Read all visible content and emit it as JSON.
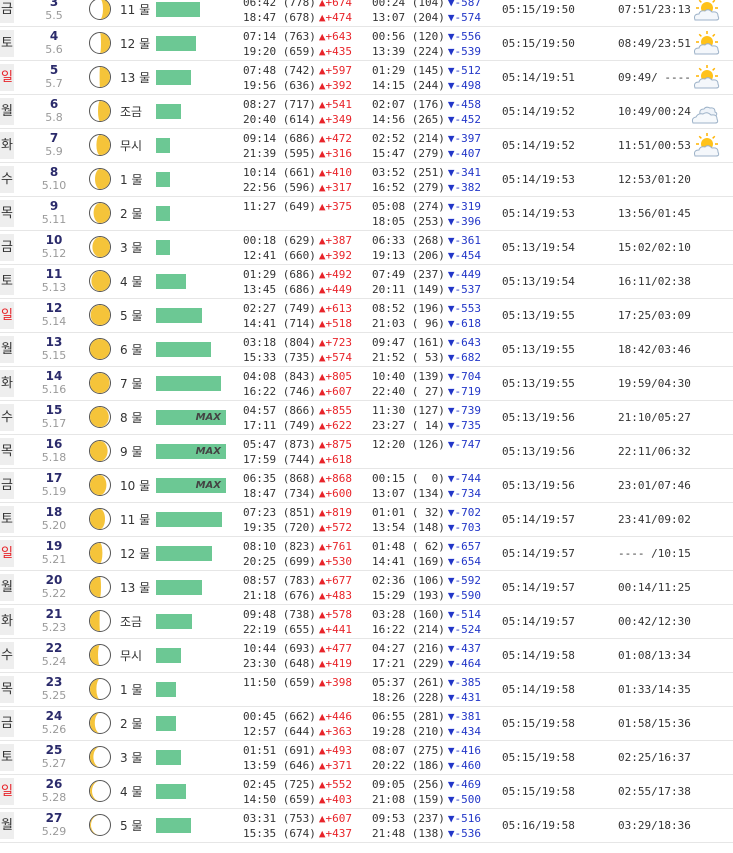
{
  "labels": {
    "max": "MAX"
  },
  "colors": {
    "bar": "#6cc894",
    "up": "#e8242a",
    "down": "#2236c8",
    "moon": "#f5c43a"
  },
  "rows": [
    {
      "dow": "금",
      "red": false,
      "day": "3",
      "lunar": "5.5",
      "illum": 0.35,
      "waxing": true,
      "mul": "11 물",
      "bar": 44,
      "max": false,
      "high1": "06:42 (778)",
      "hd1": "▲+674",
      "high2": "18:47 (678)",
      "hd2": "▲+474",
      "low1": "00:24 (104)",
      "ld1": "▼-587",
      "low2": "13:07 (204)",
      "ld2": "▼-574",
      "sun": "05:15/19:50",
      "moonrs": "07:51/23:13",
      "weather": "partly-sunny-icon"
    },
    {
      "dow": "토",
      "red": false,
      "day": "4",
      "lunar": "5.6",
      "illum": 0.45,
      "waxing": true,
      "mul": "12 물",
      "bar": 40,
      "max": false,
      "high1": "07:14 (763)",
      "hd1": "▲+643",
      "high2": "19:20 (659)",
      "hd2": "▲+435",
      "low1": "00:56 (120)",
      "ld1": "▼-556",
      "low2": "13:39 (224)",
      "ld2": "▼-539",
      "sun": "05:15/19:50",
      "moonrs": "08:49/23:51",
      "weather": "partly-sunny-icon"
    },
    {
      "dow": "일",
      "red": true,
      "day": "5",
      "lunar": "5.7",
      "illum": 0.52,
      "waxing": true,
      "mul": "13 물",
      "bar": 35,
      "max": false,
      "high1": "07:48 (742)",
      "hd1": "▲+597",
      "high2": "19:56 (636)",
      "hd2": "▲+392",
      "low1": "01:29 (145)",
      "ld1": "▼-512",
      "low2": "14:15 (244)",
      "ld2": "▼-498",
      "sun": "05:14/19:51",
      "moonrs": "09:49/ ----",
      "weather": "partly-sunny-icon"
    },
    {
      "dow": "월",
      "red": false,
      "day": "6",
      "lunar": "5.8",
      "illum": 0.6,
      "waxing": true,
      "mul": "조금",
      "bar": 25,
      "max": false,
      "high1": "08:27 (717)",
      "hd1": "▲+541",
      "high2": "20:40 (614)",
      "hd2": "▲+349",
      "low1": "02:07 (176)",
      "ld1": "▼-458",
      "low2": "14:56 (265)",
      "ld2": "▼-452",
      "sun": "05:14/19:52",
      "moonrs": "10:49/00:24",
      "weather": "cloudy-icon"
    },
    {
      "dow": "화",
      "red": false,
      "day": "7",
      "lunar": "5.9",
      "illum": 0.68,
      "waxing": true,
      "mul": "무시",
      "bar": 14,
      "max": false,
      "high1": "09:14 (686)",
      "hd1": "▲+472",
      "high2": "21:39 (595)",
      "hd2": "▲+316",
      "low1": "02:52 (214)",
      "ld1": "▼-397",
      "low2": "15:47 (279)",
      "ld2": "▼-407",
      "sun": "05:14/19:52",
      "moonrs": "11:51/00:53",
      "weather": "partly-sunny-icon"
    },
    {
      "dow": "수",
      "red": false,
      "day": "8",
      "lunar": "5.10",
      "illum": 0.75,
      "waxing": true,
      "mul": "1 물",
      "bar": 14,
      "max": false,
      "high1": "10:14 (661)",
      "hd1": "▲+410",
      "high2": "22:56 (596)",
      "hd2": "▲+317",
      "low1": "03:52 (251)",
      "ld1": "▼-341",
      "low2": "16:52 (279)",
      "ld2": "▼-382",
      "sun": "05:14/19:53",
      "moonrs": "12:53/01:20",
      "weather": ""
    },
    {
      "dow": "목",
      "red": false,
      "day": "9",
      "lunar": "5.11",
      "illum": 0.82,
      "waxing": true,
      "mul": "2 물",
      "bar": 14,
      "max": false,
      "high1": "11:27 (649)",
      "hd1": "▲+375",
      "high2": "",
      "hd2": "",
      "low1": "05:08 (274)",
      "ld1": "▼-319",
      "low2": "18:05 (253)",
      "ld2": "▼-396",
      "sun": "05:14/19:53",
      "moonrs": "13:56/01:45",
      "weather": ""
    },
    {
      "dow": "금",
      "red": false,
      "day": "10",
      "lunar": "5.12",
      "illum": 0.88,
      "waxing": true,
      "mul": "3 물",
      "bar": 14,
      "max": false,
      "high1": "00:18 (629)",
      "hd1": "▲+387",
      "high2": "12:41 (660)",
      "hd2": "▲+392",
      "low1": "06:33 (268)",
      "ld1": "▼-361",
      "low2": "19:13 (206)",
      "ld2": "▼-454",
      "sun": "05:13/19:54",
      "moonrs": "15:02/02:10",
      "weather": ""
    },
    {
      "dow": "토",
      "red": false,
      "day": "11",
      "lunar": "5.13",
      "illum": 0.93,
      "waxing": true,
      "mul": "4 물",
      "bar": 30,
      "max": false,
      "high1": "01:29 (686)",
      "hd1": "▲+492",
      "high2": "13:45 (686)",
      "hd2": "▲+449",
      "low1": "07:49 (237)",
      "ld1": "▼-449",
      "low2": "20:11 (149)",
      "ld2": "▼-537",
      "sun": "05:13/19:54",
      "moonrs": "16:11/02:38",
      "weather": ""
    },
    {
      "dow": "일",
      "red": true,
      "day": "12",
      "lunar": "5.14",
      "illum": 0.97,
      "waxing": true,
      "mul": "5 물",
      "bar": 46,
      "max": false,
      "high1": "02:27 (749)",
      "hd1": "▲+613",
      "high2": "14:41 (714)",
      "hd2": "▲+518",
      "low1": "08:52 (196)",
      "ld1": "▼-553",
      "low2": "21:03 ( 96)",
      "ld2": "▼-618",
      "sun": "05:13/19:55",
      "moonrs": "17:25/03:09",
      "weather": ""
    },
    {
      "dow": "월",
      "red": false,
      "day": "13",
      "lunar": "5.15",
      "illum": 1.0,
      "waxing": true,
      "mul": "6 물",
      "bar": 55,
      "max": false,
      "high1": "03:18 (804)",
      "hd1": "▲+723",
      "high2": "15:33 (735)",
      "hd2": "▲+574",
      "low1": "09:47 (161)",
      "ld1": "▼-643",
      "low2": "21:52 ( 53)",
      "ld2": "▼-682",
      "sun": "05:13/19:55",
      "moonrs": "18:42/03:46",
      "weather": ""
    },
    {
      "dow": "화",
      "red": false,
      "day": "14",
      "lunar": "5.16",
      "illum": 0.98,
      "waxing": false,
      "mul": "7 물",
      "bar": 65,
      "max": false,
      "high1": "04:08 (843)",
      "hd1": "▲+805",
      "high2": "16:22 (746)",
      "hd2": "▲+607",
      "low1": "10:40 (139)",
      "ld1": "▼-704",
      "low2": "22:40 ( 27)",
      "ld2": "▼-719",
      "sun": "05:13/19:55",
      "moonrs": "19:59/04:30",
      "weather": ""
    },
    {
      "dow": "수",
      "red": false,
      "day": "15",
      "lunar": "5.17",
      "illum": 0.94,
      "waxing": false,
      "mul": "8 물",
      "bar": 70,
      "max": true,
      "high1": "04:57 (866)",
      "hd1": "▲+855",
      "high2": "17:11 (749)",
      "hd2": "▲+622",
      "low1": "11:30 (127)",
      "ld1": "▼-739",
      "low2": "23:27 ( 14)",
      "ld2": "▼-735",
      "sun": "05:13/19:56",
      "moonrs": "21:10/05:27",
      "weather": ""
    },
    {
      "dow": "목",
      "red": false,
      "day": "16",
      "lunar": "5.18",
      "illum": 0.88,
      "waxing": false,
      "mul": "9 물",
      "bar": 70,
      "max": true,
      "high1": "05:47 (873)",
      "hd1": "▲+875",
      "high2": "17:59 (744)",
      "hd2": "▲+618",
      "low1": "12:20 (126)",
      "ld1": "▼-747",
      "low2": "",
      "ld2": "",
      "sun": "05:13/19:56",
      "moonrs": "22:11/06:32",
      "weather": ""
    },
    {
      "dow": "금",
      "red": false,
      "day": "17",
      "lunar": "5.19",
      "illum": 0.82,
      "waxing": false,
      "mul": "10 물",
      "bar": 70,
      "max": true,
      "high1": "06:35 (868)",
      "hd1": "▲+868",
      "high2": "18:47 (734)",
      "hd2": "▲+600",
      "low1": "00:15 (  0)",
      "ld1": "▼-744",
      "low2": "13:07 (134)",
      "ld2": "▼-734",
      "sun": "05:13/19:56",
      "moonrs": "23:01/07:46",
      "weather": ""
    },
    {
      "dow": "토",
      "red": false,
      "day": "18",
      "lunar": "5.20",
      "illum": 0.75,
      "waxing": false,
      "mul": "11 물",
      "bar": 66,
      "max": false,
      "high1": "07:23 (851)",
      "hd1": "▲+819",
      "high2": "19:35 (720)",
      "hd2": "▲+572",
      "low1": "01:01 ( 32)",
      "ld1": "▼-702",
      "low2": "13:54 (148)",
      "ld2": "▼-703",
      "sun": "05:14/19:57",
      "moonrs": "23:41/09:02",
      "weather": ""
    },
    {
      "dow": "일",
      "red": true,
      "day": "19",
      "lunar": "5.21",
      "illum": 0.62,
      "waxing": false,
      "mul": "12 물",
      "bar": 56,
      "max": false,
      "high1": "08:10 (823)",
      "hd1": "▲+761",
      "high2": "20:25 (699)",
      "hd2": "▲+530",
      "low1": "01:48 ( 62)",
      "ld1": "▼-657",
      "low2": "14:41 (169)",
      "ld2": "▼-654",
      "sun": "05:14/19:57",
      "moonrs": "---- /10:15",
      "weather": ""
    },
    {
      "dow": "월",
      "red": false,
      "day": "20",
      "lunar": "5.22",
      "illum": 0.55,
      "waxing": false,
      "mul": "13 물",
      "bar": 46,
      "max": false,
      "high1": "08:57 (783)",
      "hd1": "▲+677",
      "high2": "21:18 (676)",
      "hd2": "▲+483",
      "low1": "02:36 (106)",
      "ld1": "▼-592",
      "low2": "15:29 (193)",
      "ld2": "▼-590",
      "sun": "05:14/19:57",
      "moonrs": "00:14/11:25",
      "weather": ""
    },
    {
      "dow": "화",
      "red": false,
      "day": "21",
      "lunar": "5.23",
      "illum": 0.48,
      "waxing": false,
      "mul": "조금",
      "bar": 36,
      "max": false,
      "high1": "09:48 (738)",
      "hd1": "▲+578",
      "high2": "22:19 (655)",
      "hd2": "▲+441",
      "low1": "03:28 (160)",
      "ld1": "▼-514",
      "low2": "16:22 (214)",
      "ld2": "▼-524",
      "sun": "05:14/19:57",
      "moonrs": "00:42/12:30",
      "weather": ""
    },
    {
      "dow": "수",
      "red": false,
      "day": "22",
      "lunar": "5.24",
      "illum": 0.4,
      "waxing": false,
      "mul": "무시",
      "bar": 25,
      "max": false,
      "high1": "10:44 (693)",
      "hd1": "▲+477",
      "high2": "23:30 (648)",
      "hd2": "▲+419",
      "low1": "04:27 (216)",
      "ld1": "▼-437",
      "low2": "17:21 (229)",
      "ld2": "▼-464",
      "sun": "05:14/19:58",
      "moonrs": "01:08/13:34",
      "weather": ""
    },
    {
      "dow": "목",
      "red": false,
      "day": "23",
      "lunar": "5.25",
      "illum": 0.32,
      "waxing": false,
      "mul": "1 물",
      "bar": 20,
      "max": false,
      "high1": "11:50 (659)",
      "hd1": "▲+398",
      "high2": "",
      "hd2": "",
      "low1": "05:37 (261)",
      "ld1": "▼-385",
      "low2": "18:26 (228)",
      "ld2": "▼-431",
      "sun": "05:14/19:58",
      "moonrs": "01:33/14:35",
      "weather": ""
    },
    {
      "dow": "금",
      "red": false,
      "day": "24",
      "lunar": "5.26",
      "illum": 0.24,
      "waxing": false,
      "mul": "2 물",
      "bar": 20,
      "max": false,
      "high1": "00:45 (662)",
      "hd1": "▲+446",
      "high2": "12:57 (644)",
      "hd2": "▲+363",
      "low1": "06:55 (281)",
      "ld1": "▼-381",
      "low2": "19:28 (210)",
      "ld2": "▼-434",
      "sun": "05:15/19:58",
      "moonrs": "01:58/15:36",
      "weather": ""
    },
    {
      "dow": "토",
      "red": false,
      "day": "25",
      "lunar": "5.27",
      "illum": 0.17,
      "waxing": false,
      "mul": "3 물",
      "bar": 25,
      "max": false,
      "high1": "01:51 (691)",
      "hd1": "▲+493",
      "high2": "13:59 (646)",
      "hd2": "▲+371",
      "low1": "08:07 (275)",
      "ld1": "▼-416",
      "low2": "20:22 (186)",
      "ld2": "▼-460",
      "sun": "05:15/19:58",
      "moonrs": "02:25/16:37",
      "weather": ""
    },
    {
      "dow": "일",
      "red": true,
      "day": "26",
      "lunar": "5.28",
      "illum": 0.1,
      "waxing": false,
      "mul": "4 물",
      "bar": 30,
      "max": false,
      "high1": "02:45 (725)",
      "hd1": "▲+552",
      "high2": "14:50 (659)",
      "hd2": "▲+403",
      "low1": "09:05 (256)",
      "ld1": "▼-469",
      "low2": "21:08 (159)",
      "ld2": "▼-500",
      "sun": "05:15/19:58",
      "moonrs": "02:55/17:38",
      "weather": ""
    },
    {
      "dow": "월",
      "red": false,
      "day": "27",
      "lunar": "5.29",
      "illum": 0.05,
      "waxing": false,
      "mul": "5 물",
      "bar": 35,
      "max": false,
      "high1": "03:31 (753)",
      "hd1": "▲+607",
      "high2": "15:35 (674)",
      "hd2": "▲+437",
      "low1": "09:53 (237)",
      "ld1": "▼-516",
      "low2": "21:48 (138)",
      "ld2": "▼-536",
      "sun": "05:16/19:58",
      "moonrs": "03:29/18:36",
      "weather": ""
    }
  ]
}
